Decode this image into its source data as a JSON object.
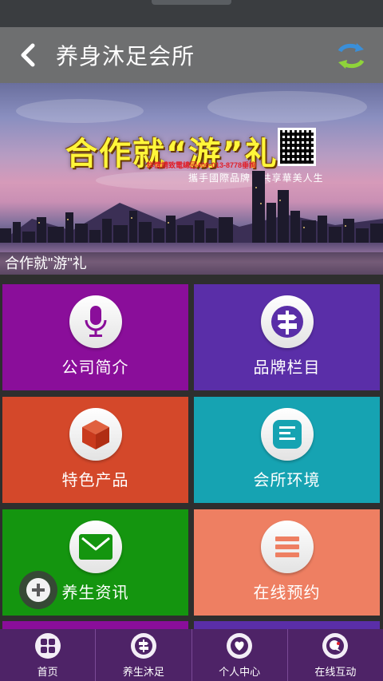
{
  "header": {
    "title": "养身沐足会所",
    "back_icon": "chevron-left-icon",
    "refresh_icon": "refresh-icon"
  },
  "banner": {
    "headline": "合作就“游”礼",
    "hotline": "詳情請致電總回400-013-8778垂詢",
    "slogan": "攜手國際品牌 · 共享華美人生",
    "caption": "合作就\"游\"礼"
  },
  "tiles": [
    {
      "label": "公司简介",
      "icon": "microphone-icon",
      "color": "#8a0e9a"
    },
    {
      "label": "品牌栏目",
      "icon": "signpost-icon",
      "color": "#5a2ea8"
    },
    {
      "label": "特色产品",
      "icon": "cube-icon",
      "color": "#d4482a"
    },
    {
      "label": "会所环境",
      "icon": "document-icon",
      "color": "#16a3b2"
    },
    {
      "label": "养生资讯",
      "icon": "envelope-icon",
      "color": "#14950f"
    },
    {
      "label": "在线预约",
      "icon": "list-icon",
      "color": "#ee7f62"
    }
  ],
  "tabbar": [
    {
      "label": "首页",
      "icon": "grid-icon"
    },
    {
      "label": "养生沐足",
      "icon": "signpost-icon"
    },
    {
      "label": "个人中心",
      "icon": "heart-icon"
    },
    {
      "label": "在线互动",
      "icon": "chat-icon"
    }
  ],
  "colors": {
    "titlebar": "#6e6f70",
    "tabbar": "#4e2367",
    "statusbar": "#3a3d40"
  }
}
